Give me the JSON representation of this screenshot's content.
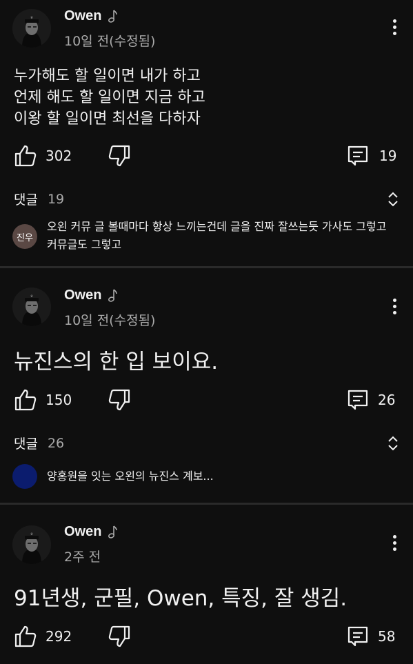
{
  "posts": [
    {
      "author": "Owen",
      "time": "10일 전(수정됨)",
      "content_lines": [
        "누가해도 할 일이면 내가 하고",
        "언제 해도 할 일이면 지금 하고",
        "이왕 할 일이면 최선을 다하자"
      ],
      "likes": "302",
      "replies": "19",
      "comments_label": "댓글",
      "comments_count": "19",
      "preview_avatar_text": "진우",
      "preview_avatar_color": "#5a4844",
      "preview_text": "오왼 커뮤 글 볼때마다 항상 느끼는건데 글을 진짜 잘쓰는듯 가사도 그렇고 커뮤글도 그렇고"
    },
    {
      "author": "Owen",
      "time": "10일 전(수정됨)",
      "content_lines": [
        "뉴진스의 한 입 보이요."
      ],
      "likes": "150",
      "replies": "26",
      "comments_label": "댓글",
      "comments_count": "26",
      "preview_avatar_text": "",
      "preview_avatar_color": "#0b1c6e",
      "preview_text": "양홍원을 잇는 오왼의 뉴진스 계보..."
    },
    {
      "author": "Owen",
      "time": "2주 전",
      "content_lines": [
        "91년생, 군필, Owen, 특징, 잘 생김."
      ],
      "likes": "292",
      "replies": "58"
    }
  ],
  "icons": {
    "avatar": "owen-avatar-icon",
    "note": "music-note-icon",
    "more": "more-vert-icon",
    "like": "thumbs-up-icon",
    "dislike": "thumbs-down-icon",
    "reply": "comment-icon",
    "expand": "unfold-icon"
  },
  "colors": {
    "background": "#0f0f0f",
    "text": "#f1f1f1",
    "secondary": "#aaaaaa",
    "separator": "#2a2a2a"
  }
}
